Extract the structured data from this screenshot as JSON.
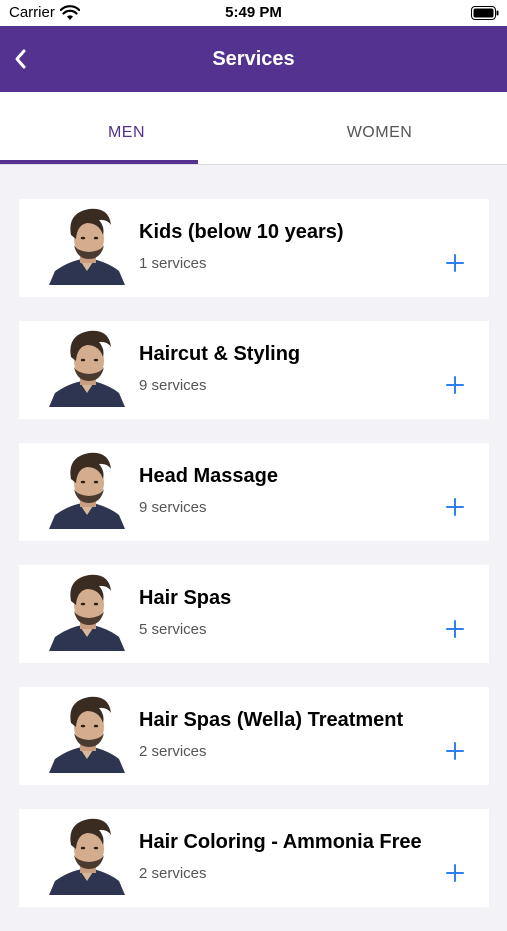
{
  "status_bar": {
    "carrier": "Carrier",
    "time": "5:49 PM"
  },
  "header": {
    "title": "Services"
  },
  "tabs": [
    {
      "label": "MEN",
      "selected": true
    },
    {
      "label": "WOMEN",
      "selected": false
    }
  ],
  "services": [
    {
      "name": "Kids (below 10 years)",
      "count": "1 services"
    },
    {
      "name": "Haircut & Styling",
      "count": "9 services"
    },
    {
      "name": "Head Massage",
      "count": "9 services"
    },
    {
      "name": "Hair Spas",
      "count": "5 services"
    },
    {
      "name": "Hair Spas (Wella) Treatment",
      "count": "2 services"
    },
    {
      "name": "Hair Coloring - Ammonia Free",
      "count": "2 services"
    }
  ],
  "colors": {
    "primary": "#54328F",
    "accent": "#2F80ED",
    "background": "#F2F2F7"
  },
  "icons": {
    "back": "chevron-left-icon",
    "add": "plus-icon"
  }
}
